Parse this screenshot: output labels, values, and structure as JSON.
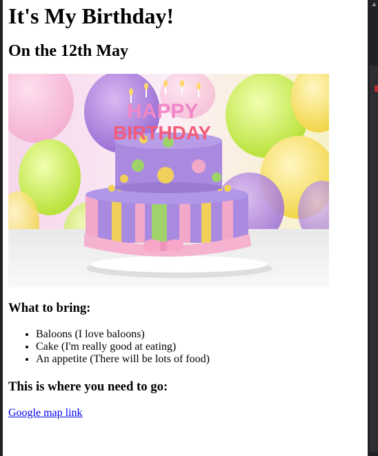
{
  "page": {
    "title": "It's My Birthday!",
    "date_heading": "On the 12th May",
    "hero_image": {
      "description": "birthday-cake-photo",
      "topper_line1": "HAPPY",
      "topper_line2": "BIRTHDAY"
    },
    "bring_section": {
      "heading": "What to bring:",
      "items": [
        "Baloons (I love baloons)",
        "Cake (I'm really good at eating)",
        "An appetite (There will be lots of food)"
      ]
    },
    "location_section": {
      "heading": "This is where you need to go:",
      "link_text": "Google map link"
    }
  },
  "colors": {
    "link": "#0000ee",
    "page_background": "#ffffff",
    "chrome_background": "#202124"
  }
}
